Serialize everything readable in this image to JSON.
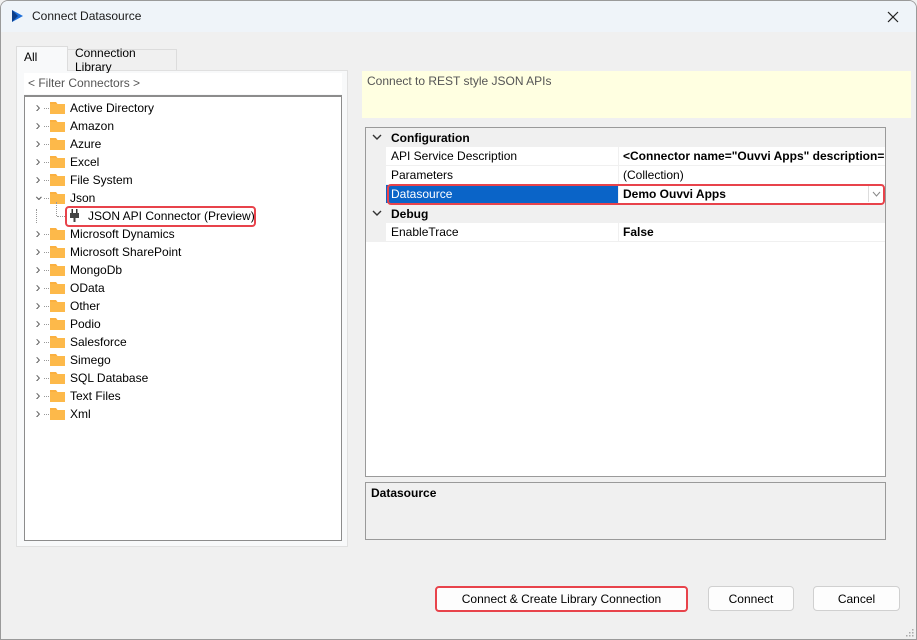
{
  "window": {
    "title": "Connect Datasource",
    "close_icon": "close-icon",
    "app_icon": "play-logo-icon"
  },
  "tabs": [
    {
      "label": "All",
      "active": true
    },
    {
      "label": "Connection Library",
      "active": false
    }
  ],
  "filter": {
    "placeholder": "< Filter Connectors >",
    "value": ""
  },
  "tree": {
    "items": [
      {
        "label": "Active Directory",
        "expanded": false,
        "icon": "folder-icon"
      },
      {
        "label": "Amazon",
        "expanded": false,
        "icon": "folder-icon"
      },
      {
        "label": "Azure",
        "expanded": false,
        "icon": "folder-icon"
      },
      {
        "label": "Excel",
        "expanded": false,
        "icon": "folder-icon"
      },
      {
        "label": "File System",
        "expanded": false,
        "icon": "folder-icon"
      },
      {
        "label": "Json",
        "expanded": true,
        "icon": "folder-icon",
        "children": [
          {
            "label": "JSON API Connector (Preview)",
            "icon": "plug-icon",
            "selected": true
          }
        ]
      },
      {
        "label": "Microsoft Dynamics",
        "expanded": false,
        "icon": "folder-icon"
      },
      {
        "label": "Microsoft SharePoint",
        "expanded": false,
        "icon": "folder-icon"
      },
      {
        "label": "MongoDb",
        "expanded": false,
        "icon": "folder-icon"
      },
      {
        "label": "OData",
        "expanded": false,
        "icon": "folder-icon"
      },
      {
        "label": "Other",
        "expanded": false,
        "icon": "folder-icon"
      },
      {
        "label": "Podio",
        "expanded": false,
        "icon": "folder-icon"
      },
      {
        "label": "Salesforce",
        "expanded": false,
        "icon": "folder-icon"
      },
      {
        "label": "Simego",
        "expanded": false,
        "icon": "folder-icon"
      },
      {
        "label": "SQL Database",
        "expanded": false,
        "icon": "folder-icon"
      },
      {
        "label": "Text Files",
        "expanded": false,
        "icon": "folder-icon"
      },
      {
        "label": "Xml",
        "expanded": false,
        "icon": "folder-icon"
      }
    ]
  },
  "description": "Connect to REST style JSON APIs",
  "property_grid": {
    "categories": [
      {
        "label": "Configuration",
        "properties": [
          {
            "name": "API Service Description",
            "value": "<Connector name=\"Ouvvi Apps\" description=\"\"",
            "bold": true
          },
          {
            "name": "Parameters",
            "value": "(Collection)",
            "bold": false
          },
          {
            "name": "Datasource",
            "value": "Demo Ouvvi Apps",
            "bold": true,
            "selected": true,
            "has_dropdown": true
          }
        ]
      },
      {
        "label": "Debug",
        "properties": [
          {
            "name": "EnableTrace",
            "value": "False",
            "bold": true
          }
        ]
      }
    ]
  },
  "help": {
    "title": "Datasource",
    "text": ""
  },
  "buttons": {
    "create_library": "Connect & Create Library Connection",
    "connect": "Connect",
    "cancel": "Cancel"
  },
  "colors": {
    "highlight": "#e8434b",
    "selection": "#0a64c8",
    "folder": "#fbb040",
    "description_bg": "#ffffe1"
  }
}
